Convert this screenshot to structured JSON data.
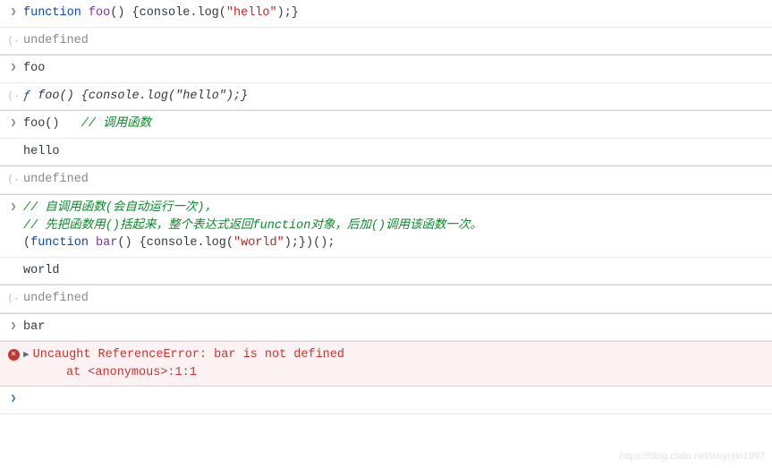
{
  "rows": [
    {
      "type": "input",
      "tokens": [
        {
          "t": "function",
          "c": "kw"
        },
        {
          "t": " "
        },
        {
          "t": "foo",
          "c": "fn-name"
        },
        {
          "t": "() {"
        },
        {
          "t": "console"
        },
        {
          "t": "."
        },
        {
          "t": "log"
        },
        {
          "t": "("
        },
        {
          "t": "\"hello\"",
          "c": "str"
        },
        {
          "t": ");}"
        }
      ]
    },
    {
      "type": "output-undef",
      "value": "undefined"
    },
    {
      "type": "input",
      "sep": true,
      "tokens": [
        {
          "t": "foo"
        }
      ]
    },
    {
      "type": "output-fn",
      "tokens": [
        {
          "t": "ƒ ",
          "c": "fsym"
        },
        {
          "t": "foo() {console.log(\"hello\");}",
          "c": "ret-italic"
        }
      ]
    },
    {
      "type": "input",
      "sep": true,
      "tokens": [
        {
          "t": "foo()"
        },
        {
          "t": "   "
        },
        {
          "t": "// 调用函数",
          "c": "cmt"
        }
      ]
    },
    {
      "type": "log",
      "value": "hello"
    },
    {
      "type": "output-undef",
      "sep": true,
      "value": "undefined"
    },
    {
      "type": "input",
      "sep": true,
      "tokens": [
        {
          "t": "// 自调用函数(会自动运行一次)，",
          "c": "cmt"
        },
        {
          "br": true
        },
        {
          "t": "// 先把函数用()括起来，整个表达式返回",
          "c": "cmt"
        },
        {
          "t": "function",
          "c": "cmt"
        },
        {
          "t": "对象，后加()调用该函数一次。",
          "c": "cmt"
        },
        {
          "br": true
        },
        {
          "t": "("
        },
        {
          "t": "function",
          "c": "kw"
        },
        {
          "t": " "
        },
        {
          "t": "bar",
          "c": "fn-name"
        },
        {
          "t": "() {"
        },
        {
          "t": "console"
        },
        {
          "t": "."
        },
        {
          "t": "log"
        },
        {
          "t": "("
        },
        {
          "t": "\"world\"",
          "c": "str"
        },
        {
          "t": ");})();"
        }
      ]
    },
    {
      "type": "log",
      "value": "world"
    },
    {
      "type": "output-undef",
      "sep": true,
      "value": "undefined"
    },
    {
      "type": "input",
      "sep": true,
      "tokens": [
        {
          "t": "bar"
        }
      ]
    },
    {
      "type": "error",
      "message": "Uncaught ReferenceError: bar is not defined",
      "at": "at <anonymous>:1:1"
    },
    {
      "type": "prompt"
    }
  ],
  "chart_data": {
    "type": "table",
    "title": "DevTools console session",
    "entries": [
      {
        "kind": "input",
        "text": "function foo() {console.log(\"hello\");}"
      },
      {
        "kind": "return",
        "text": "undefined"
      },
      {
        "kind": "input",
        "text": "foo"
      },
      {
        "kind": "return",
        "text": "ƒ foo() {console.log(\"hello\");}"
      },
      {
        "kind": "input",
        "text": "foo()   // 调用函数"
      },
      {
        "kind": "log",
        "text": "hello"
      },
      {
        "kind": "return",
        "text": "undefined"
      },
      {
        "kind": "input",
        "text": "// 自调用函数(会自动运行一次)，\n// 先把函数用()括起来，整个表达式返回function对象，后加()调用该函数一次。\n(function bar() {console.log(\"world\");})();"
      },
      {
        "kind": "log",
        "text": "world"
      },
      {
        "kind": "return",
        "text": "undefined"
      },
      {
        "kind": "input",
        "text": "bar"
      },
      {
        "kind": "error",
        "text": "Uncaught ReferenceError: bar is not defined\n    at <anonymous>:1:1"
      }
    ]
  },
  "watermark": "https://blog.csdn.net/wuyujin1997"
}
